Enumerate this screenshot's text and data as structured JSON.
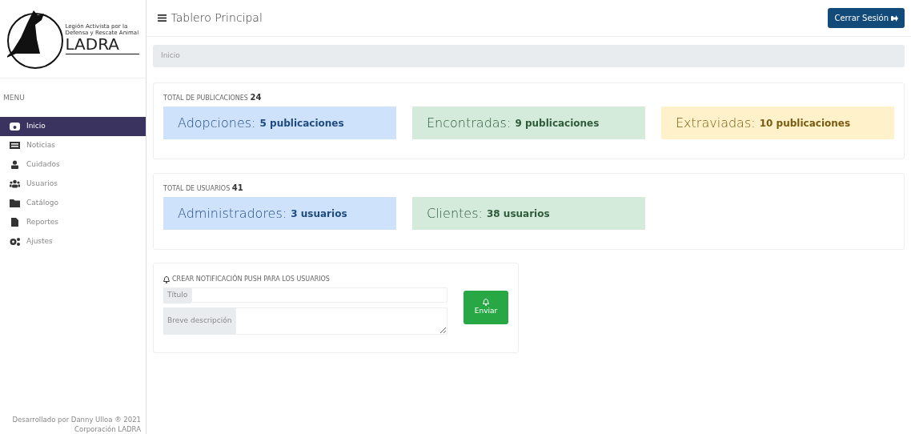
{
  "sidebar": {
    "logo": {
      "title": "LADRA",
      "tagline": "Legión Activista por la Defensa y Rescate Animal"
    },
    "menu_label": "MENU",
    "items": [
      {
        "label": "Inicio",
        "selected": true
      },
      {
        "label": "Noticias",
        "selected": false
      },
      {
        "label": "Cuidados",
        "selected": false
      },
      {
        "label": "Usuarios",
        "selected": false
      },
      {
        "label": "Catálogo",
        "selected": false
      },
      {
        "label": "Reportes",
        "selected": false
      },
      {
        "label": "Ajustes",
        "selected": false
      }
    ],
    "footer": [
      "Desarrollado por Danny Ulloa ® 2021",
      "Corporación LADRA"
    ]
  },
  "header": {
    "title": "Tablero Principal",
    "logout_button": "Cerrar Sesión"
  },
  "breadcrumb": "Inicio",
  "sections": [
    {
      "heading": "TOTAL DE PUBLICACIONES",
      "total": "24",
      "tiles": [
        {
          "label": "Adopciones:",
          "value": "5 publicaciones",
          "kind": "info"
        },
        {
          "label": "Encontradas:",
          "value": "9 publicaciones",
          "kind": "success"
        },
        {
          "label": "Extraviadas:",
          "value": "10 publicaciones",
          "kind": "warning"
        }
      ]
    },
    {
      "heading": "TOTAL DE USUARIOS",
      "total": "41",
      "tiles": [
        {
          "label": "Administradores:",
          "value": "3 usuarios",
          "kind": "info"
        },
        {
          "label": "Clientes:",
          "value": "38 usuarios",
          "kind": "success"
        }
      ]
    }
  ],
  "notification": {
    "heading": "CREAR NOTIFICACIÓN PUSH PARA LOS USUARIOS",
    "fields": [
      {
        "label": "Título",
        "kind": "input"
      },
      {
        "label": "Breve descripción",
        "kind": "textarea"
      }
    ],
    "button": "Enviar"
  }
}
